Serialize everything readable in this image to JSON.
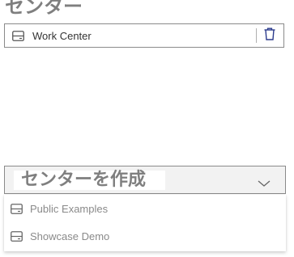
{
  "section": {
    "heading": "センター"
  },
  "selected_center": {
    "label": "Work Center",
    "icon": "server-icon",
    "action_icon": "trash-icon"
  },
  "create_select": {
    "label": "センターを作成",
    "icon": "chevron-down-icon"
  },
  "options": [
    {
      "label": "Public Examples",
      "icon": "server-icon"
    },
    {
      "label": "Showcase Demo",
      "icon": "server-icon"
    }
  ],
  "colors": {
    "accent": "#2b3a8c",
    "text_muted": "#8a8a8a",
    "heading": "#7f7f7f",
    "border": "#8a8a8a"
  }
}
